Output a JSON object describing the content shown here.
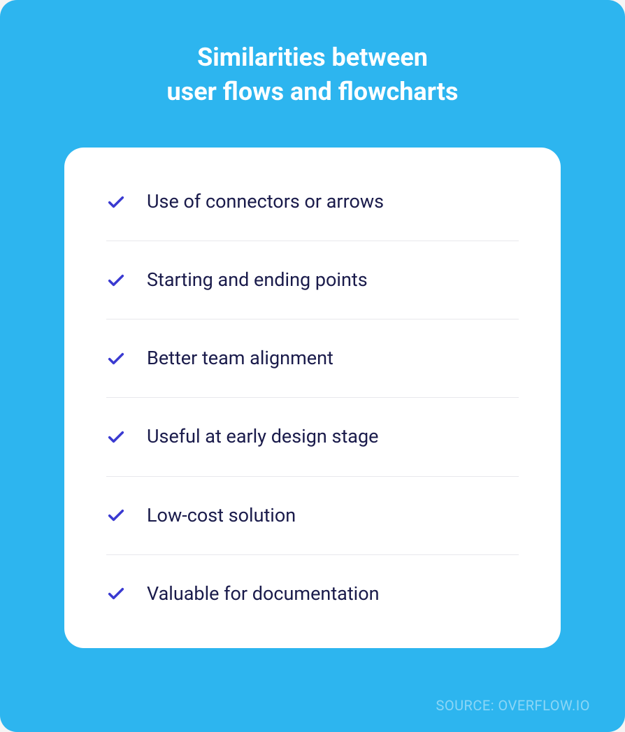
{
  "title_line1": "Similarities between",
  "title_line2": "user flows and flowcharts",
  "items": [
    {
      "text": "Use of connectors or arrows"
    },
    {
      "text": "Starting and ending points"
    },
    {
      "text": "Better team alignment"
    },
    {
      "text": "Useful at early design stage"
    },
    {
      "text": "Low-cost solution"
    },
    {
      "text": "Valuable for documentation"
    }
  ],
  "source": "SOURCE: OVERFLOW.IO",
  "colors": {
    "background": "#2db5ef",
    "card": "#ffffff",
    "text": "#1a1b4b",
    "check": "#3a3ad1"
  }
}
